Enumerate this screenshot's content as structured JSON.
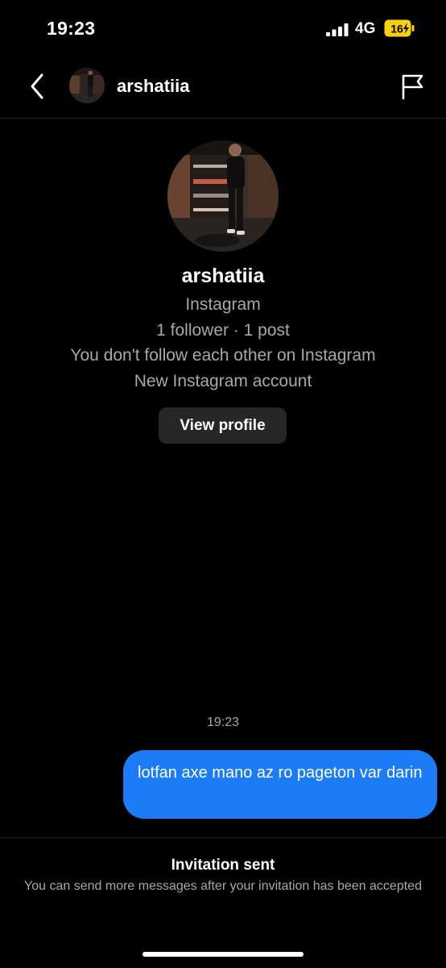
{
  "status_bar": {
    "time": "19:23",
    "network": "4G",
    "battery": "16"
  },
  "header": {
    "username": "arshatiia"
  },
  "profile": {
    "name": "arshatiia",
    "source": "Instagram",
    "stats": "1 follower · 1 post",
    "follow_status": "You don't follow each other on Instagram",
    "account_note": "New Instagram account",
    "view_profile_label": "View profile"
  },
  "messages": [
    {
      "time": "19:23",
      "text": "lotfan axe mano az ro pageton var darin",
      "from": "me"
    }
  ],
  "footer": {
    "title": "Invitation sent",
    "subtitle": "You can send more messages after your invitation has been accepted"
  },
  "colors": {
    "accent": "#1b7cf5",
    "battery": "#f5d20b"
  }
}
